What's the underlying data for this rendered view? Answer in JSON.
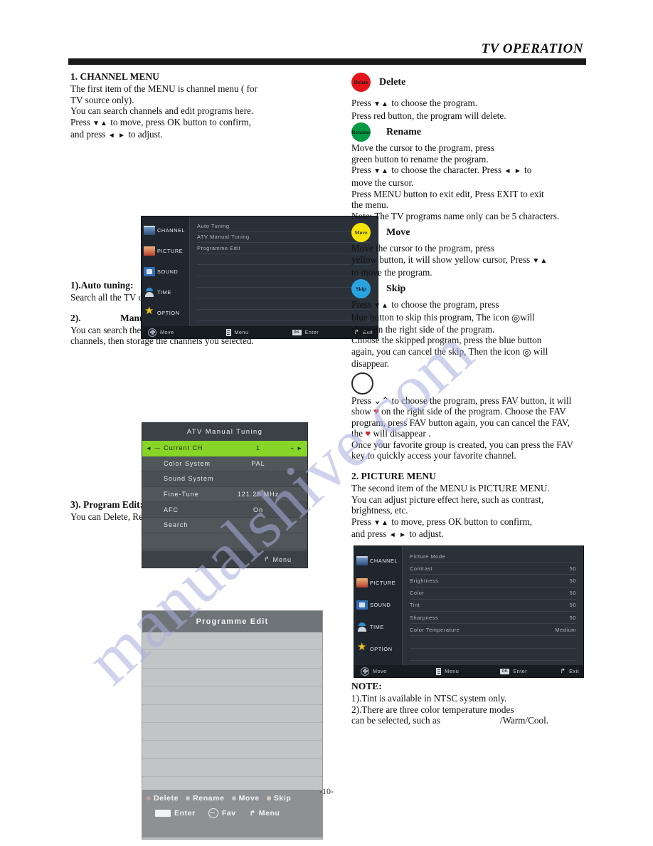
{
  "header": {
    "title": "TV OPERATION"
  },
  "page_number": "-10-",
  "watermark": {
    "text": "manualshive.com"
  },
  "left_column": {
    "channel_menu": {
      "heading": "1. CHANNEL MENU",
      "body": "The first item of the MENU is channel menu ( for TV source only).\nYou can search channels and edit programs here.\nPress  ▼▲ to move, press OK button to confirm, and press ◄ ► to adjust."
    },
    "auto_tuning": {
      "heading": "1).Auto tuning:",
      "body": "Search all the TV channels automatically."
    },
    "manual_tuning": {
      "heading_num": "2).",
      "heading": "Manual tuning:",
      "body": "You can search the TV channels and fine tune the channels, then storage the channels you selected."
    },
    "program_edit": {
      "heading": "3). Program Edit:",
      "body": "You can Delete, Rename, Move, or Skip any programs."
    }
  },
  "osd_channel": {
    "sidebar": [
      {
        "label": "CHANNEL",
        "icon": "channel-icon"
      },
      {
        "label": "PICTURE",
        "icon": "picture-icon"
      },
      {
        "label": "SOUND",
        "icon": "sound-icon"
      },
      {
        "label": "TIME",
        "icon": "time-icon"
      },
      {
        "label": "OPTION",
        "icon": "option-icon"
      }
    ],
    "rows": [
      {
        "name": "Auto Tuning",
        "value": ""
      },
      {
        "name": "ATV Manual Tuning",
        "value": ""
      },
      {
        "name": "Programme Edit",
        "value": ""
      },
      {
        "name": "",
        "value": ""
      },
      {
        "name": "",
        "value": ""
      },
      {
        "name": "",
        "value": ""
      },
      {
        "name": "",
        "value": ""
      },
      {
        "name": "",
        "value": ""
      },
      {
        "name": "",
        "value": ""
      }
    ],
    "footer": [
      {
        "label": "Move",
        "icon": "dpad-icon"
      },
      {
        "label": "Menu",
        "icon": "menu-icon"
      },
      {
        "label": "Enter",
        "icon": "ok-icon"
      },
      {
        "label": "Exit",
        "icon": "exit-icon"
      }
    ]
  },
  "atv_manual_tuning": {
    "title": "ATV Manual Tuning",
    "rows": [
      {
        "name": "Current CH",
        "value": "1",
        "selected": true
      },
      {
        "name": "Color System",
        "value": "PAL",
        "selected": false
      },
      {
        "name": "Sound System",
        "value": "",
        "selected": false
      },
      {
        "name": "Fine-Tune",
        "value": "121.25 MHz",
        "selected": false
      },
      {
        "name": "AFC",
        "value": "On",
        "selected": false
      },
      {
        "name": "Search",
        "value": "",
        "selected": false
      }
    ],
    "footer": {
      "label": "Menu",
      "icon": "exit-icon"
    }
  },
  "programme_edit": {
    "title": "Programme Edit",
    "row_count": 9,
    "footer_row1": [
      {
        "label": "Delete",
        "color": "red"
      },
      {
        "label": "Rename",
        "color": "green"
      },
      {
        "label": "Move",
        "color": "blue"
      },
      {
        "label": "Skip",
        "color": "yellow"
      }
    ],
    "footer_row2": [
      {
        "label": "Enter",
        "icon": "key-icon"
      },
      {
        "label": "Fav",
        "icon": "fav-icon"
      },
      {
        "label": "Menu",
        "icon": "exit-icon"
      }
    ]
  },
  "right_column": {
    "delete": {
      "button_text": "Delete",
      "title": "Delete",
      "color": "#e3151b",
      "body": "Press  ▼▲  to choose the program.\nPress red button, the program will delete."
    },
    "rename": {
      "button_text": "Rename",
      "title": "Rename",
      "color": "#079a45",
      "body": "Move the cursor to the program, press green button to rename the program.\nPress  ▼▲  to choose the character. Press ◄ ► to move the cursor.\nPress MENU button to exit edit, Press EXIT to exit the menu.\nNote: The TV programs name only can be 5 characters."
    },
    "move": {
      "button_text": "Move",
      "title": "Move",
      "color": "#f5e400",
      "body": "Move the cursor to the program, press yellow button, it will show yellow cursor, Press ▼▲ to move the program."
    },
    "skip": {
      "button_text": "Skip",
      "title": "Skip",
      "color": "#29a3e0",
      "body_1": "Press ▼▲ to choose the program, press blue button to skip this program, The icon",
      "body_2": "will show on the right side of the program.",
      "body_3": "Choose the skipped program, press the blue button again, you can cancel the skip, Then the icon",
      "body_4": "will disappear."
    },
    "fav": {
      "button_text": "",
      "body_1": "Press ⌄⌃ to choose the program, press FAV button, it will show",
      "body_2": "on the right side of the program. Choose the FAV program, press FAV button again, you can cancel the FAV, the",
      "body_3": "will disappear .",
      "body_4": "Once your favorite group is created, you can press the FAV key to quickly access your favorite channel."
    },
    "picture_menu": {
      "heading": "2. PICTURE MENU",
      "body": "The second item of the MENU is PICTURE MENU.\nYou can adjust picture effect here, such as contrast, brightness, etc.\nPress ▼▲ to move, press OK button to confirm, and press ◄ ► to adjust."
    },
    "note": {
      "heading": "NOTE:",
      "line1": "1).Tint is available in NTSC system only.",
      "line2a": "2).There are three color temperature modes",
      "line2b": "can be selected, such as",
      "line2c": "/Warm/Cool."
    }
  },
  "osd_picture": {
    "sidebar": [
      {
        "label": "CHANNEL",
        "icon": "channel-icon"
      },
      {
        "label": "PICTURE",
        "icon": "picture-icon"
      },
      {
        "label": "SOUND",
        "icon": "sound-icon"
      },
      {
        "label": "TIME",
        "icon": "time-icon"
      },
      {
        "label": "OPTION",
        "icon": "option-icon"
      }
    ],
    "rows": [
      {
        "name": "Picture Mode",
        "value": ""
      },
      {
        "name": "Contrast",
        "value": "50"
      },
      {
        "name": "Brightness",
        "value": "50"
      },
      {
        "name": "Color",
        "value": "50"
      },
      {
        "name": "Tint",
        "value": "50"
      },
      {
        "name": "Sharpness",
        "value": "50"
      },
      {
        "name": "Color Temperature",
        "value": "Medium"
      },
      {
        "name": "",
        "value": ""
      },
      {
        "name": "",
        "value": ""
      }
    ],
    "footer": [
      {
        "label": "Move",
        "icon": "dpad-icon"
      },
      {
        "label": "Menu",
        "icon": "menu-icon"
      },
      {
        "label": "Enter",
        "icon": "ok-icon"
      },
      {
        "label": "Exit",
        "icon": "exit-icon"
      }
    ]
  }
}
